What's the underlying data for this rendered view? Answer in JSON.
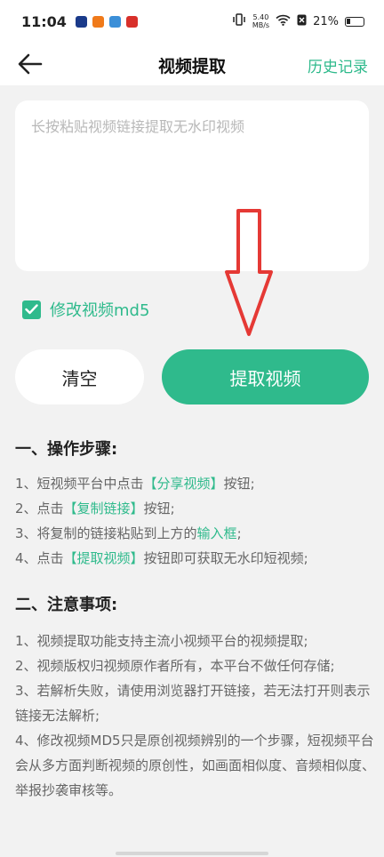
{
  "status_bar": {
    "time": "11:04",
    "speed_value": "5.40",
    "speed_unit": "MB/s",
    "battery": "21%"
  },
  "nav": {
    "title": "视频提取",
    "history": "历史记录"
  },
  "input": {
    "placeholder": "长按粘贴视频链接提取无水印视频",
    "value": ""
  },
  "md5": {
    "label": "修改视频md5",
    "checked": true
  },
  "buttons": {
    "clear": "清空",
    "extract": "提取视频"
  },
  "steps": {
    "title": "一、操作步骤:",
    "items": [
      {
        "pre": "1、短视频平台中点击",
        "hl": "【分享视频】",
        "post": "按钮;"
      },
      {
        "pre": "2、点击",
        "hl": "【复制链接】",
        "post": "按钮;"
      },
      {
        "pre": "3、将复制的链接粘贴到上方的",
        "hl": "输入框",
        "post": ";"
      },
      {
        "pre": "4、点击",
        "hl": "【提取视频】",
        "post": "按钮即可获取无水印短视频;"
      }
    ]
  },
  "notes": {
    "title": "二、注意事项:",
    "items": [
      "1、视频提取功能支持主流小视频平台的视频提取;",
      "2、视频版权归视频原作者所有，本平台不做任何存储;",
      "3、若解析失败，请使用浏览器打开链接，若无法打开则表示链接无法解析;",
      "4、修改视频MD5只是原创视频辨别的一个步骤，短视频平台会从多方面判断视频的原创性，如画面相似度、音频相似度、举报抄袭审核等。"
    ]
  },
  "colors": {
    "accent": "#2fba8c",
    "arrow": "#e53935"
  }
}
